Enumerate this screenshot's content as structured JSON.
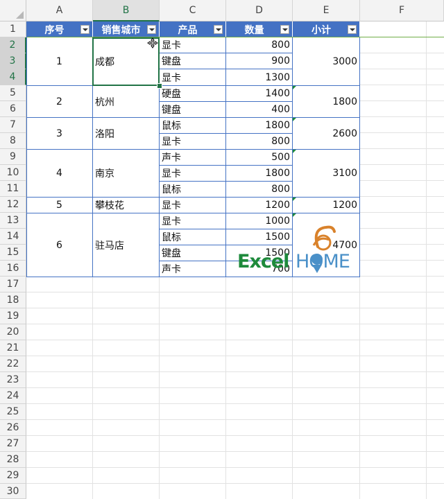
{
  "columns": [
    "A",
    "B",
    "C",
    "D",
    "E",
    "F"
  ],
  "rows": [
    "1",
    "2",
    "3",
    "4",
    "5",
    "6",
    "7",
    "8",
    "9",
    "10",
    "11",
    "12",
    "13",
    "14",
    "15",
    "16",
    "17",
    "18",
    "19",
    "20",
    "21",
    "22",
    "23",
    "24",
    "25",
    "26",
    "27",
    "28",
    "29",
    "30"
  ],
  "headers": {
    "seq": "序号",
    "city": "销售城市",
    "product": "产品",
    "qty": "数量",
    "subtotal": "小计"
  },
  "groups": [
    {
      "seq": "1",
      "city": "成都",
      "subtotal": "3000"
    },
    {
      "seq": "2",
      "city": "杭州",
      "subtotal": "1800"
    },
    {
      "seq": "3",
      "city": "洛阳",
      "subtotal": "2600"
    },
    {
      "seq": "4",
      "city": "南京",
      "subtotal": "3100"
    },
    {
      "seq": "5",
      "city": "攀枝花",
      "subtotal": "1200"
    },
    {
      "seq": "6",
      "city": "驻马店",
      "subtotal": "4700"
    }
  ],
  "items": [
    {
      "product": "显卡",
      "qty": "800"
    },
    {
      "product": "键盘",
      "qty": "900"
    },
    {
      "product": "显卡",
      "qty": "1300"
    },
    {
      "product": "硬盘",
      "qty": "1400"
    },
    {
      "product": "键盘",
      "qty": "400"
    },
    {
      "product": "鼠标",
      "qty": "1800"
    },
    {
      "product": "显卡",
      "qty": "800"
    },
    {
      "product": "声卡",
      "qty": "500"
    },
    {
      "product": "显卡",
      "qty": "1800"
    },
    {
      "product": "鼠标",
      "qty": "800"
    },
    {
      "product": "显卡",
      "qty": "1200"
    },
    {
      "product": "显卡",
      "qty": "1000"
    },
    {
      "product": "鼠标",
      "qty": "1500"
    },
    {
      "product": "键盘",
      "qty": "1500"
    },
    {
      "product": "声卡",
      "qty": "700"
    }
  ],
  "logo": {
    "part1": "Excel",
    "part2": "HOME"
  },
  "colors": {
    "header_bg": "#4472c4",
    "selection": "#217346",
    "logo_green": "#1e8a3c",
    "logo_blue": "#4a90c8",
    "logo_orange": "#d9822b"
  }
}
